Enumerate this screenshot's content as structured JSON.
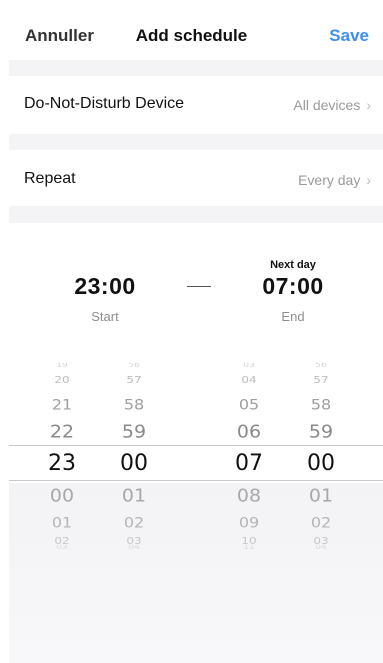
{
  "header": {
    "cancel_label": "Annuller",
    "title": "Add schedule",
    "save_label": "Save"
  },
  "rows": {
    "device": {
      "label": "Do-Not-Disturb Device",
      "value": "All devices"
    },
    "repeat": {
      "label": "Repeat",
      "value": "Every day"
    }
  },
  "schedule": {
    "start": {
      "time": "23:00",
      "label": "Start"
    },
    "end": {
      "time": "07:00",
      "label": "End",
      "note": "Next day"
    }
  },
  "picker": {
    "start_hour": [
      "19",
      "20",
      "21",
      "22",
      "23",
      "00",
      "01",
      "02",
      "03"
    ],
    "start_minute": [
      "56",
      "57",
      "58",
      "59",
      "00",
      "01",
      "02",
      "03",
      "04"
    ],
    "end_hour": [
      "03",
      "04",
      "05",
      "06",
      "07",
      "08",
      "09",
      "10",
      "11"
    ],
    "end_minute": [
      "56",
      "57",
      "58",
      "59",
      "00",
      "01",
      "02",
      "03",
      "04"
    ]
  },
  "colors": {
    "accent": "#3d8ff0",
    "separator": "#f4f4f6",
    "muted_text": "#9a9a9a"
  }
}
